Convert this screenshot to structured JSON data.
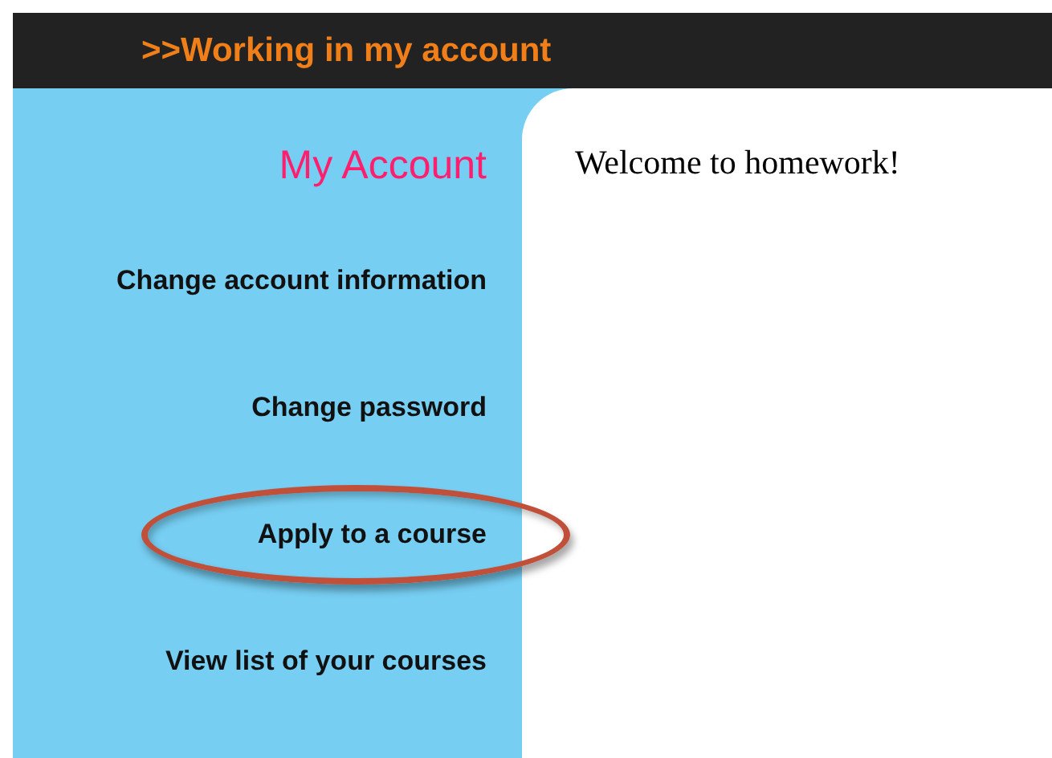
{
  "header": {
    "title": ">>Working in my account"
  },
  "sidebar": {
    "title": "My Account",
    "items": [
      {
        "label": "Change account information",
        "highlighted": false
      },
      {
        "label": "Change password",
        "highlighted": false
      },
      {
        "label": "Apply to a course",
        "highlighted": true
      },
      {
        "label": "View list of your courses",
        "highlighted": false
      }
    ]
  },
  "content": {
    "text": "Welcome to homework!"
  }
}
